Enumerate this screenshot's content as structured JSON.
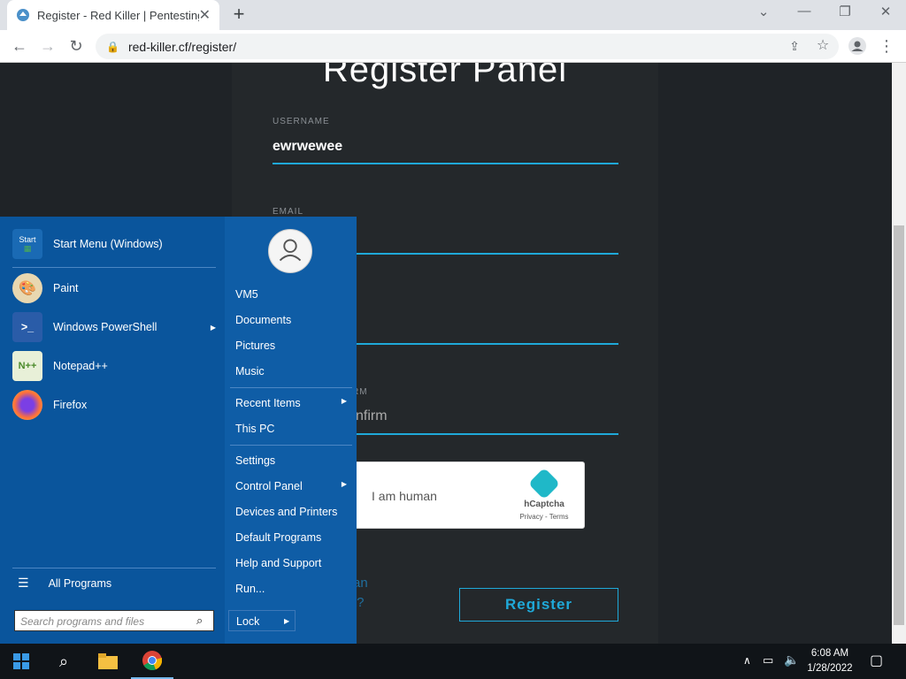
{
  "browser": {
    "tab_title": "Register - Red Killer | Pentesting",
    "tab_close": "✕",
    "new_tab": "+",
    "url": "red-killer.cf/register/",
    "window_controls": {
      "dropdown": "⌄",
      "minimize": "—",
      "restore": "❐",
      "close": "✕"
    }
  },
  "page": {
    "title": "Register Panel",
    "fields": [
      {
        "label": "USERNAME",
        "value": "ewrwewee"
      },
      {
        "label": "EMAIL",
        "value": ""
      },
      {
        "label": "",
        "value": ""
      },
      {
        "label": "RM",
        "value": "nfirm"
      }
    ],
    "captcha": {
      "label": "I am human",
      "brand": "hCaptcha",
      "links": "Privacy - Terms"
    },
    "login_link_lines": [
      "an",
      "t?"
    ],
    "register_button": "Register"
  },
  "start_menu": {
    "pinned": [
      {
        "label": "Start Menu (Windows)",
        "icon": "start-menu-icon"
      },
      {
        "label": "Paint",
        "icon": "paint-icon"
      },
      {
        "label": "Windows PowerShell",
        "icon": "powershell-icon",
        "submenu": true
      },
      {
        "label": "Notepad++",
        "icon": "notepadpp-icon"
      },
      {
        "label": "Firefox",
        "icon": "firefox-icon"
      }
    ],
    "start_icon_text": "Start",
    "all_programs": "All Programs",
    "search_placeholder": "Search programs and files",
    "right": {
      "user": "VM5",
      "group1": [
        "Documents",
        "Pictures",
        "Music"
      ],
      "group2": [
        "Recent Items",
        "This PC"
      ],
      "group3": [
        "Settings",
        "Control Panel",
        "Devices and Printers",
        "Default Programs",
        "Help and Support",
        "Run..."
      ],
      "lock": "Lock"
    }
  },
  "taskbar": {
    "time": "6:08 AM",
    "date": "1/28/2022",
    "icons": [
      "windows-start-icon",
      "search-icon",
      "file-explorer-icon",
      "chrome-icon"
    ]
  }
}
